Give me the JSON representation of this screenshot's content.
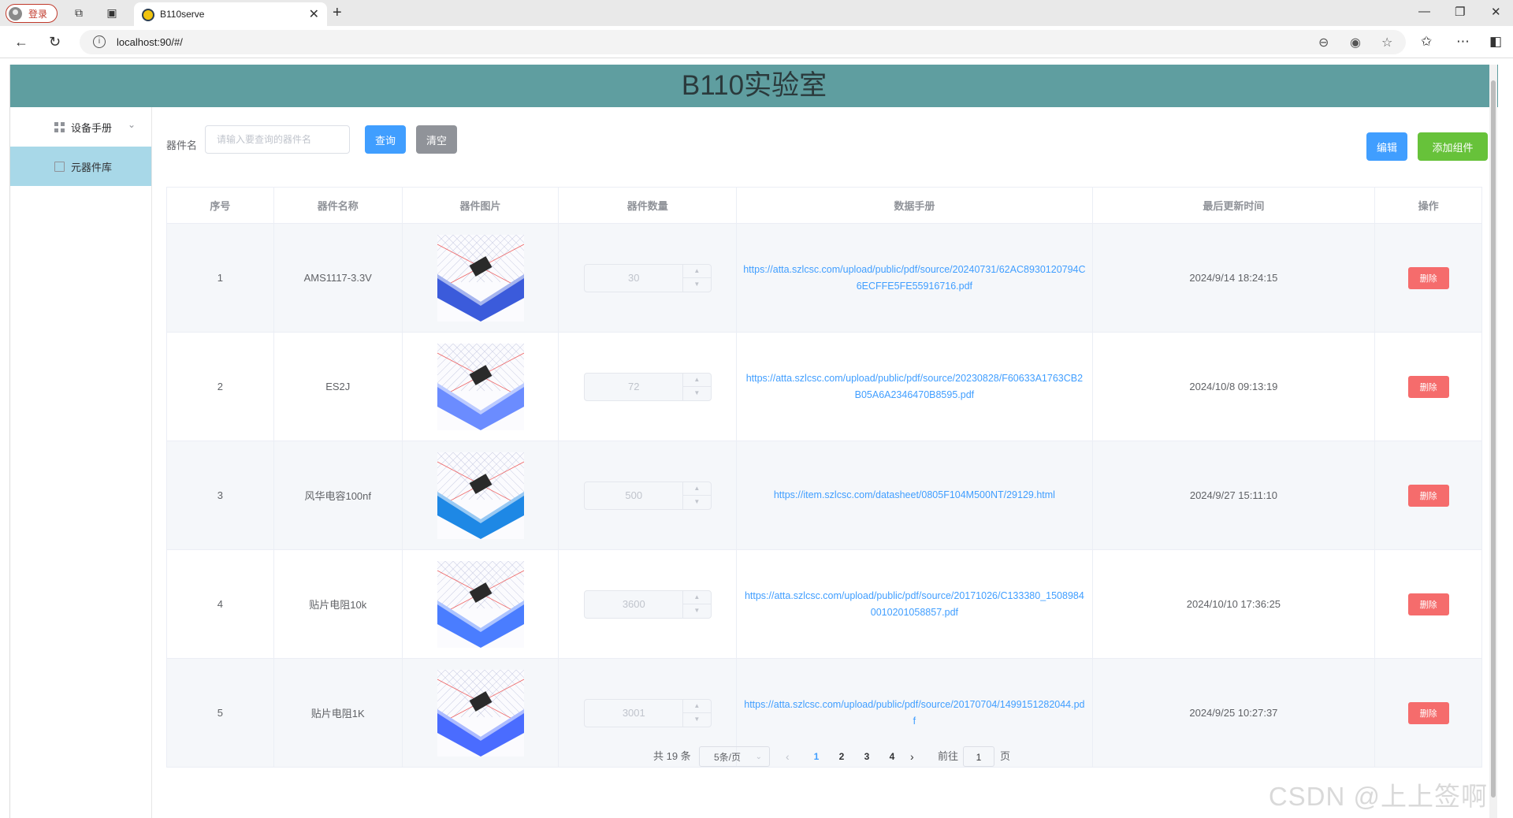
{
  "browser": {
    "profile_label": "登录",
    "tab_title": "B110serve",
    "url": "localhost:90/#/"
  },
  "header": {
    "title": "B110实验室"
  },
  "sidebar": {
    "items": [
      {
        "label": "设备手册",
        "icon": "grid-icon"
      },
      {
        "label": "元器件库",
        "icon": "document-icon"
      }
    ]
  },
  "search": {
    "label": "器件名",
    "placeholder": "请输入要查询的器件名",
    "query_label": "查询",
    "clear_label": "清空"
  },
  "toolbar": {
    "edit_label": "编辑",
    "add_label": "添加组件"
  },
  "table": {
    "headers": [
      "序号",
      "器件名称",
      "器件图片",
      "器件数量",
      "数据手册",
      "最后更新时间",
      "操作"
    ],
    "rows": [
      {
        "index": "1",
        "name": "AMS1117-3.3V",
        "quantity": "30",
        "datasheet": "https://atta.szlcsc.com/upload/public/pdf/source/20240731/62AC8930120794C6ECFFE5FE55916716.pdf",
        "updated": "2024/9/14 18:24:15",
        "action": "删除"
      },
      {
        "index": "2",
        "name": "ES2J",
        "quantity": "72",
        "datasheet": "https://atta.szlcsc.com/upload/public/pdf/source/20230828/F60633A1763CB2B05A6A2346470B8595.pdf",
        "updated": "2024/10/8 09:13:19",
        "action": "删除"
      },
      {
        "index": "3",
        "name": "风华电容100nf",
        "quantity": "500",
        "datasheet": "https://item.szlcsc.com/datasheet/0805F104M500NT/29129.html",
        "updated": "2024/9/27 15:11:10",
        "action": "删除"
      },
      {
        "index": "4",
        "name": "贴片电阻10k",
        "quantity": "3600",
        "datasheet": "https://atta.szlcsc.com/upload/public/pdf/source/20171026/C133380_15089840010201058857.pdf",
        "updated": "2024/10/10 17:36:25",
        "action": "删除"
      },
      {
        "index": "5",
        "name": "贴片电阻1K",
        "quantity": "3001",
        "datasheet": "https://atta.szlcsc.com/upload/public/pdf/source/20170704/1499151282044.pdf",
        "updated": "2024/9/25 10:27:37",
        "action": "删除"
      }
    ]
  },
  "pagination": {
    "total": "共 19 条",
    "page_size": "5条/页",
    "pages": [
      "1",
      "2",
      "3",
      "4"
    ],
    "current": "1",
    "goto_prefix": "前往",
    "goto_value": "1",
    "goto_suffix": "页"
  },
  "watermark": "CSDN @上上签啊"
}
